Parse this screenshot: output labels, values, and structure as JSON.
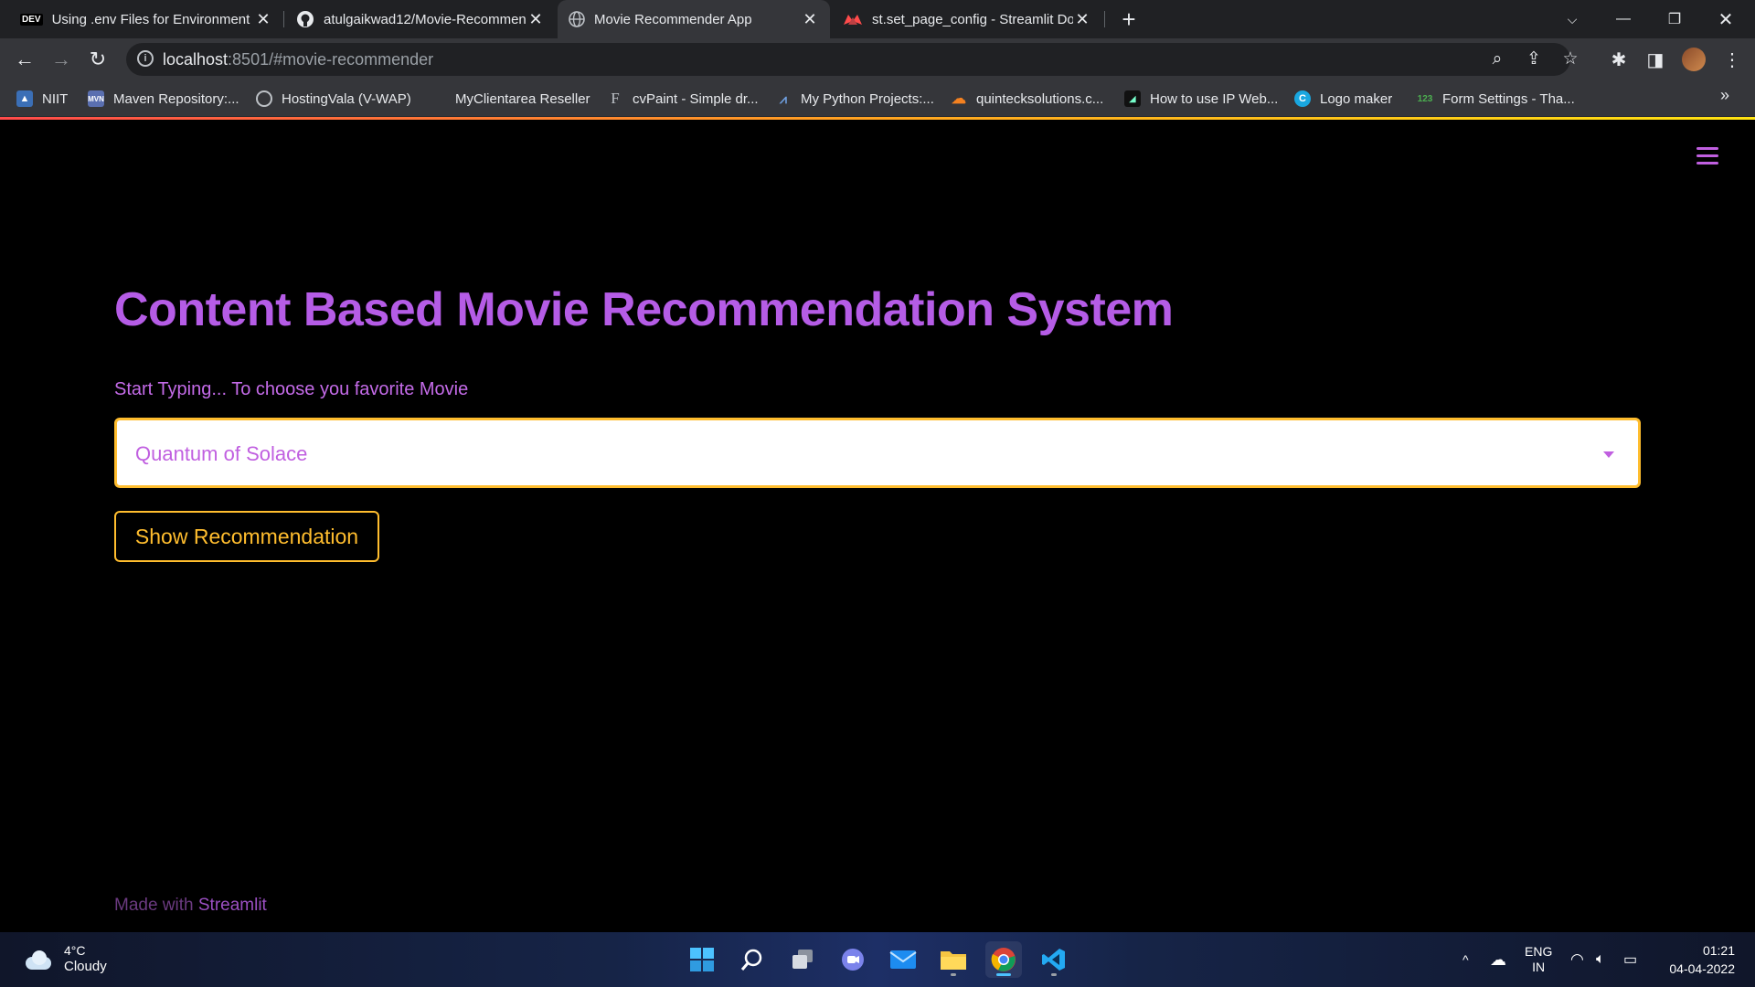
{
  "browser": {
    "tabs": [
      {
        "title": "Using .env Files for Environment",
        "favicon": "DEV"
      },
      {
        "title": "atulgaikwad12/Movie-Recommen",
        "favicon": "github-icon"
      },
      {
        "title": "Movie Recommender App",
        "favicon": "globe-icon"
      },
      {
        "title": "st.set_page_config - Streamlit Do",
        "favicon": "streamlit-icon"
      }
    ],
    "url_host": "localhost",
    "url_rest": ":8501/#movie-recommender",
    "bookmarks": [
      {
        "label": "NIIT"
      },
      {
        "label": "Maven Repository:..."
      },
      {
        "label": "HostingVala (V-WAP)"
      },
      {
        "label": "MyClientarea Reseller"
      },
      {
        "label": "cvPaint - Simple dr..."
      },
      {
        "label": "My Python Projects:..."
      },
      {
        "label": "quinteckso­lutions.c..."
      },
      {
        "label": "How to use IP Web..."
      },
      {
        "label": "Logo maker"
      },
      {
        "label": "Form Settings - Tha..."
      }
    ]
  },
  "app": {
    "title": "Content Based Movie Recommendation System",
    "select_label": "Start Typing... To choose you favorite Movie",
    "selected_movie": "Quantum of Solace",
    "button_label": "Show Recommendation",
    "footer_prefix": "Made with ",
    "footer_link": "Streamlit",
    "colors": {
      "accent": "#b55ce6",
      "button": "#ffbd2e",
      "background": "#000000"
    }
  },
  "taskbar": {
    "temperature": "4°C",
    "weather": "Cloudy",
    "lang_top": "ENG",
    "lang_bottom": "IN",
    "time": "01:21",
    "date": "04-04-2022"
  }
}
